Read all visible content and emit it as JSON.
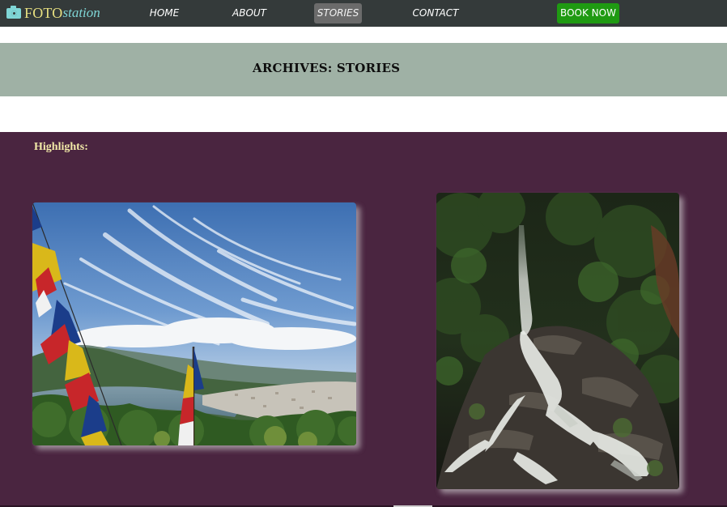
{
  "nav": {
    "brand_foto": "FOTO",
    "brand_station": "station",
    "brand_icon": "camera-icon",
    "links": [
      "HOME",
      "ABOUT",
      "STORIES",
      "CONTACT"
    ],
    "active_link": "STORIES",
    "book_label": "BOOK NOW"
  },
  "banner": {
    "title": "ARCHIVES: STORIES"
  },
  "highlights": {
    "label": "Highlights:",
    "photos": [
      {
        "subject": "prayer-flags-valley-photo"
      },
      {
        "subject": "waterfall-photo"
      }
    ]
  },
  "colors": {
    "nav_bg": "#343a3a",
    "active_tab_bg": "#6b6b6b",
    "book_button": "#1f9a12",
    "banner_bg": "#9fb1a5",
    "section_bg": "#4a2540",
    "brand_accent": "#7fd6d6",
    "brand_text": "#e8e080",
    "highlights_text": "#f2eaa8"
  }
}
